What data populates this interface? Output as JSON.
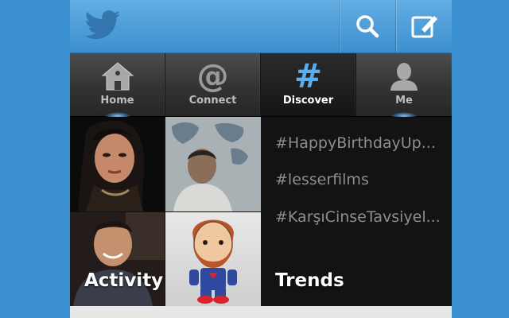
{
  "topbar": {
    "logo_icon": "twitter-bird-icon",
    "search_icon": "search-icon",
    "compose_icon": "compose-icon",
    "color": "#4a9ad8"
  },
  "tabs": [
    {
      "label": "Home",
      "icon": "home-icon",
      "active": false
    },
    {
      "label": "Connect",
      "icon": "at-sign-icon",
      "glyph": "@",
      "active": false
    },
    {
      "label": "Discover",
      "icon": "hashtag-icon",
      "glyph": "#",
      "active": true
    },
    {
      "label": "Me",
      "icon": "person-icon",
      "active": false
    }
  ],
  "activity": {
    "label": "Activity",
    "photos": [
      "woman-portrait",
      "man-with-map",
      "smiling-man",
      "cartoon-avatar"
    ]
  },
  "trends": {
    "label": "Trends",
    "items": [
      "#HappyBirthdayUp...",
      "#lesserfilms",
      "#KarşıCinseTavsiyel..."
    ]
  },
  "accent_color": "#5aaef0"
}
